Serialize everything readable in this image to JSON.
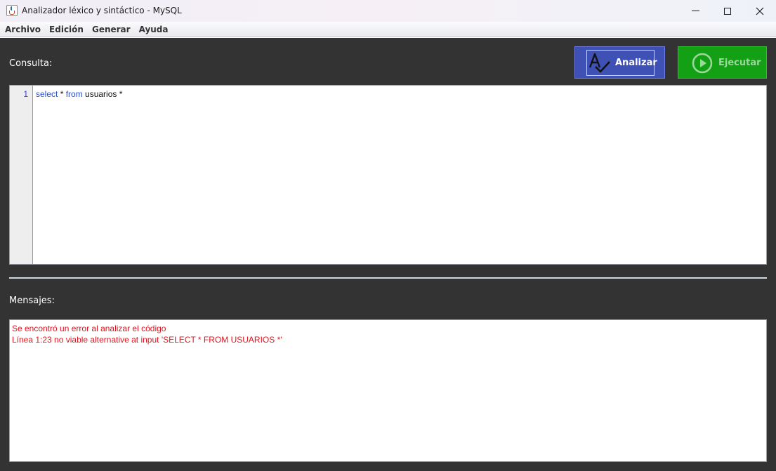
{
  "window": {
    "title": "Analizador léxico y sintáctico - MySQL",
    "app_icon": "java-cup-icon"
  },
  "menu": [
    "Archivo",
    "Edición",
    "Generar",
    "Ayuda"
  ],
  "consulta": {
    "label": "Consulta:",
    "line_number": "1",
    "code_tokens": [
      {
        "text": "select",
        "type": "keyword"
      },
      {
        "text": " * ",
        "type": "plain"
      },
      {
        "text": "from",
        "type": "keyword"
      },
      {
        "text": " usuarios *",
        "type": "plain"
      }
    ]
  },
  "buttons": {
    "analizar": {
      "label": "Analizar",
      "icon": "spell-check-icon",
      "color": "#3f51b5"
    },
    "ejecutar": {
      "label": "Ejecutar",
      "icon": "play-circle-icon",
      "color": "#14a014"
    }
  },
  "mensajes": {
    "label": "Mensajes:",
    "lines": [
      "Se encontró un error al analizar el código",
      "Línea 1:23 no viable alternative at input 'SELECT * FROM USUARIOS *'"
    ],
    "text_color": "#e0141e"
  }
}
